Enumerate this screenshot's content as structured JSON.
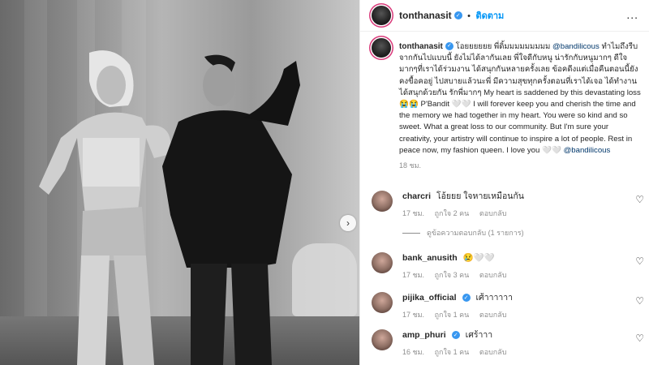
{
  "header": {
    "username": "tonthanasit",
    "separator": "•",
    "follow_label": "ติดตาม",
    "more_label": "..."
  },
  "caption": {
    "username": "tonthanasit",
    "text_1": "โอยยยยยย พี่ดิ้มมมมมมมมม",
    "mention_1": "@bandilicous",
    "text_2": "ทำไมถึงรีบจากกันไปแบบนี้ ยังไม่ได้ลากันเลย พี่ใจดีกับหนู น่ารักกับหนูมากๆ ดีใจมากๆที่เราได้ร่วมงาน ได้สนุกกันหลายครั้งเลย ข้อคดีงแต่เมื่อคืนตอนนี้ยังคงขื้อคอยู่ ไปสบายแล้วนะพี่ มีความสุขทุกครั้งตอนที่เราได้เจอ ได้ทำงาน ได้สนุกด้วยกัน รักพี่มากๆ My heart is saddened by this devastating loss 😭😭 P'Bandit 🤍🤍 I will forever keep you and cherish the time and the memory we had together in my heart. You were so kind and so sweet. What a great loss to our community. But I'm sure your creativity, your artistry will continue to inspire a lot of people. Rest in peace now, my fashion queen. I love you 🤍🤍",
    "mention_2": "@bandilicous",
    "time": "18 ชม."
  },
  "comments": [
    {
      "username": "charcri",
      "verified": false,
      "text": "โอ้ยยย ใจหายเหมือนกัน",
      "time": "17 ชม.",
      "likes": "ถูกใจ 2 คน",
      "reply": "ตอบกลับ"
    },
    {
      "username": "bank_anusith",
      "verified": false,
      "text": "😢🤍🤍",
      "time": "17 ชม.",
      "likes": "ถูกใจ 3 คน",
      "reply": "ตอบกลับ"
    },
    {
      "username": "pijika_official",
      "verified": true,
      "text": "เศ้าาาาาา",
      "time": "17 ชม.",
      "likes": "ถูกใจ 1 คน",
      "reply": "ตอบกลับ"
    },
    {
      "username": "amp_phuri",
      "verified": true,
      "text": "เศร้าาา",
      "time": "16 ชม.",
      "likes": "ถูกใจ 1 คน",
      "reply": "ตอบกลับ"
    }
  ],
  "view_replies": "ดูข้อความตอบกลับ (1 รายการ)",
  "nav_next": "›",
  "verified_mark": "✓",
  "heart_glyph": "♡",
  "colors": {
    "accent": "#0095f6",
    "verified": "#3897f0",
    "mention": "#00376b",
    "meta": "#8e8e8e"
  }
}
